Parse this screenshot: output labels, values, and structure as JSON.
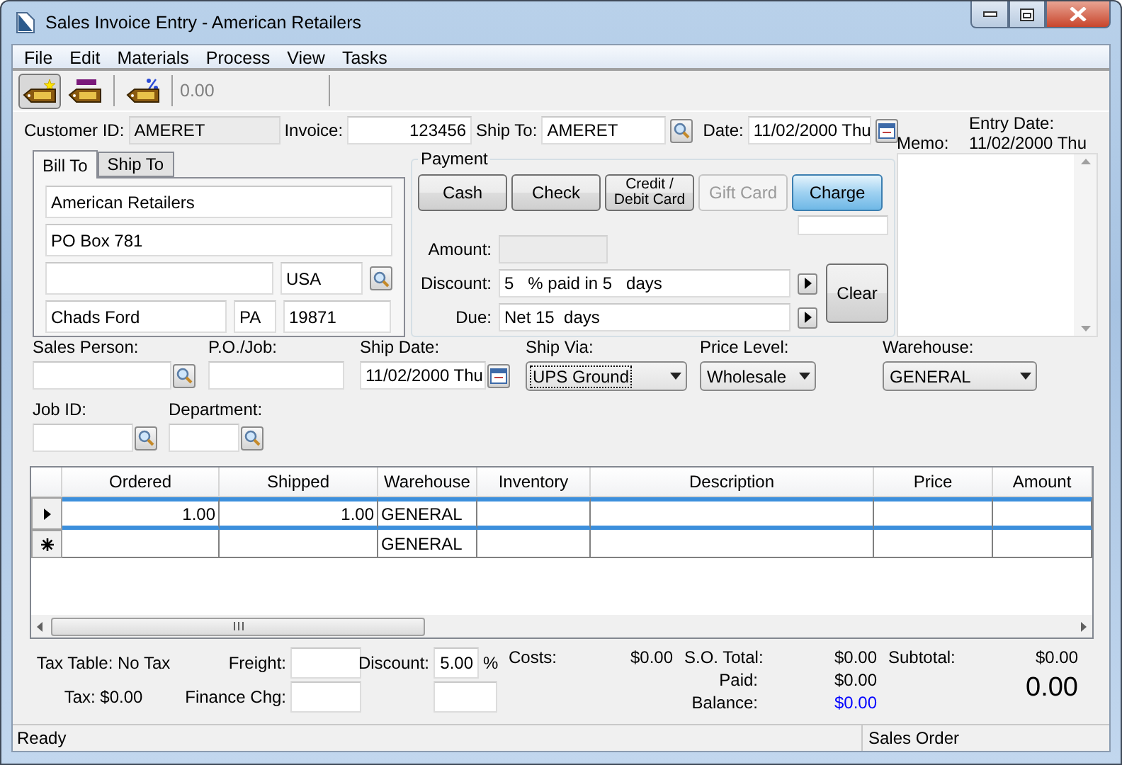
{
  "window": {
    "title": "Sales Invoice Entry - American Retailers"
  },
  "menu": [
    "File",
    "Edit",
    "Materials",
    "Process",
    "View",
    "Tasks"
  ],
  "toolbar": {
    "buttons": [
      {
        "kind": "new",
        "selected": true
      },
      {
        "kind": "level",
        "selected": false
      },
      {
        "kind": "percent",
        "selected": false
      }
    ],
    "value": "0.00"
  },
  "header": {
    "customer_id": {
      "label": "Customer ID:",
      "value": "AMERET"
    },
    "invoice": {
      "label": "Invoice:",
      "value": "123456"
    },
    "ship_to": {
      "label": "Ship To:",
      "value": "AMERET"
    },
    "date": {
      "label": "Date:",
      "value": "11/02/2000 Thu"
    },
    "entry_date": {
      "label": "Entry Date:",
      "value": "11/02/2000 Thu"
    }
  },
  "memo": {
    "label": "Memo:"
  },
  "address_tabs": [
    {
      "label": "Bill To",
      "selected": true
    },
    {
      "label": "Ship To",
      "selected": false
    }
  ],
  "address": {
    "name": "American Retailers",
    "street": "PO Box 781",
    "country": "USA",
    "city": "Chads Ford",
    "state": "PA",
    "zip": "19871"
  },
  "payment": {
    "title": "Payment",
    "methods": [
      {
        "label": "Cash",
        "selected": false,
        "disabled": false
      },
      {
        "label": "Check",
        "selected": false,
        "disabled": false
      },
      {
        "label": "Credit / Debit Card",
        "selected": false,
        "disabled": false
      },
      {
        "label": "Gift Card",
        "selected": false,
        "disabled": true
      },
      {
        "label": "Charge",
        "selected": true,
        "disabled": false
      }
    ],
    "amount": {
      "label": "Amount:"
    },
    "discount": {
      "label": "Discount:",
      "value": "5   % paid in 5   days"
    },
    "due": {
      "label": "Due:",
      "value": "Net 15  days"
    },
    "clear": "Clear"
  },
  "details": {
    "sales_person": {
      "label": "Sales Person:"
    },
    "po_job": {
      "label": "P.O./Job:"
    },
    "ship_date": {
      "label": "Ship Date:",
      "value": "11/02/2000 Thu"
    },
    "ship_via": {
      "label": "Ship Via:",
      "value": "UPS Ground",
      "focused": true
    },
    "price_level": {
      "label": "Price Level:",
      "value": "Wholesale",
      "focused": false
    },
    "warehouse": {
      "label": "Warehouse:",
      "value": "GENERAL",
      "focused": false
    },
    "job_id": {
      "label": "Job ID:"
    },
    "department": {
      "label": "Department:"
    }
  },
  "grid": {
    "columns": [
      "Ordered",
      "Shipped",
      "Warehouse",
      "Inventory",
      "Description",
      "Price",
      "Amount"
    ],
    "rows": [
      {
        "kind": "current",
        "selected": true,
        "cells": {
          "ordered": "1.00",
          "shipped": "1.00",
          "warehouse": "GENERAL"
        }
      },
      {
        "kind": "new",
        "selected": false,
        "cells": {
          "warehouse": "GENERAL"
        }
      }
    ]
  },
  "totals": {
    "tax_table": "Tax Table: No Tax",
    "tax": "Tax: $0.00",
    "freight": {
      "label": "Freight:"
    },
    "finance_charge": {
      "label": "Finance Chg:"
    },
    "discount": {
      "label": "Discount:",
      "value": "5.00",
      "unit": "%"
    },
    "costs": {
      "label": "Costs:",
      "value": "$0.00"
    },
    "so_total": {
      "label": "S.O. Total:",
      "value": "$0.00"
    },
    "paid": {
      "label": "Paid:",
      "value": "$0.00"
    },
    "balance": {
      "label": "Balance:",
      "value": "$0.00"
    },
    "subtotal": {
      "label": "Subtotal:",
      "value": "$0.00"
    },
    "total": "0.00"
  },
  "status_bar": {
    "message": "Ready",
    "mode": "Sales Order"
  }
}
